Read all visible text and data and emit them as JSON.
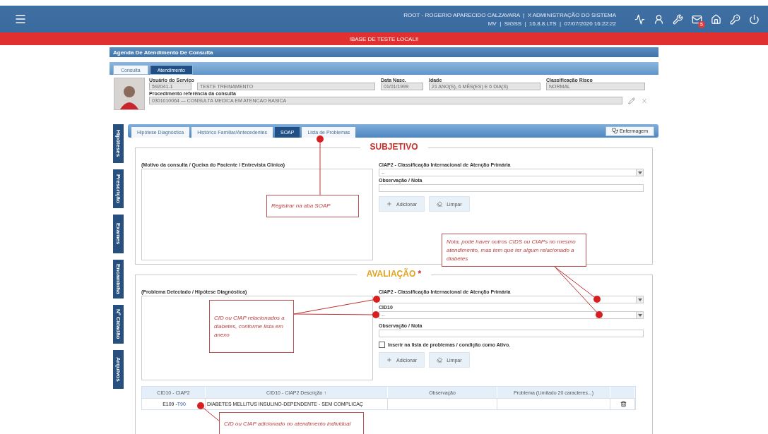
{
  "header": {
    "user_line": "ROOT - ROGERIO APARECIDO CALZAVARA  |  X ADMINISTRAÇÃO DO SISTEMA",
    "info_line": "MV  |  SIGSS  |  16.8.8.LTS  |  07/07/2020 16:22:22",
    "mail_badge": "5"
  },
  "banner": "!BASE DE TESTE LOCAL!!",
  "window": {
    "title": "Agenda De Atendimento De Consulta",
    "tabs": [
      {
        "label": "Consulta",
        "selected": false
      },
      {
        "label": "Atendimento",
        "selected": true
      }
    ],
    "patient": {
      "user_label": "Usuário do Serviço",
      "user_code": "592041-1",
      "user_name": "TESTE TREINAMENTO",
      "birth_label": "Data Nasc.",
      "birth": "01/01/1999",
      "age_label": "Idade",
      "age": "21 ANO(S), 6 MÊS(ES) E 6 DIA(S)",
      "risk_label": "Classificação Risco",
      "risk": "NORMAL",
      "procedure_label": "Procedimento referência da consulta",
      "procedure": "0301010064 — CONSULTA MEDICA EM ATENCAO BASICA"
    },
    "side_tabs": [
      "Hipóteses",
      "Prescrição",
      "Exames",
      "Encaminha",
      "Nº Cidadão",
      "Arquivos"
    ],
    "inner_tabs": [
      {
        "label": "Hipótese Diagnóstica",
        "selected": false
      },
      {
        "label": "Histórico Familiar/Antecedentes",
        "selected": false
      },
      {
        "label": "SOAP",
        "selected": true
      },
      {
        "label": "Lista de Problemas",
        "selected": false
      }
    ],
    "nursing_button": "Enfermagem",
    "subjetivo": {
      "title": "SUBJETIVO",
      "text_label": "(Motivo da consulta / Queixa do Paciente / Entrevista Clínica)",
      "ciap_label": "CIAP2 - Classificação Internacional de Atenção Primária",
      "ciap_value": "--",
      "obs_label": "Observação / Nota",
      "buttons": [
        "Adicionar",
        "Limpar"
      ]
    },
    "avaliacao": {
      "title": "AVALIAÇÃO",
      "required": "*",
      "text_label": "(Problema Detectado / Hipótese Diagnóstica)",
      "ciap_label": "CIAP2 - Classificação Internacional de Atenção Primária",
      "cid_label": "CID10",
      "cid_value": "--",
      "obs_label": "Observação / Nota",
      "checkbox": {
        "label": "Inserir na lista de problemas / condição como Ativo.",
        "checked": false
      },
      "buttons": [
        "Adicionar",
        "Limpar"
      ]
    },
    "table": {
      "columns": [
        "CID10 - CIAP2",
        "CID10 - CIAP2 Descrição ↑",
        "Observação",
        "Problema (Limitado 20 caracteres...)"
      ],
      "rows": [
        {
          "cid": "E109 - ",
          "ciap": "T90",
          "description": "DIABETES MELLITUS INSULINO-DEPENDENTE - SEM COMPLICAÇ"
        }
      ]
    }
  },
  "annotations": [
    {
      "text": "Registrar na aba SOAP"
    },
    {
      "text": "Nota, pode haver outros CIDS ou CIAPs no mesmo atendimento, mas tem que ter algum relacionado a diabetes"
    },
    {
      "text": "CID ou CIAP relacionados a diabetes, conforme lista em anexo"
    },
    {
      "text": "CID ou CIAP adicionado no atendimento individual"
    }
  ]
}
